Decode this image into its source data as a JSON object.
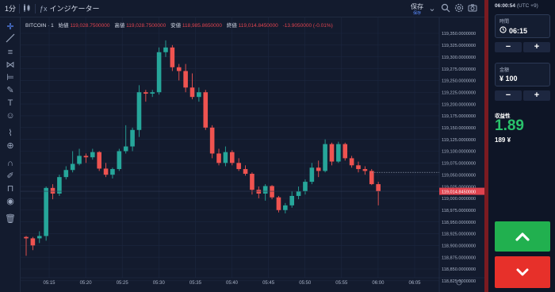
{
  "toolbar": {
    "timeframe": "1分",
    "indicators": "インジケーター",
    "save": "保存",
    "save_sub": "保存"
  },
  "legend": {
    "symbol": "BITCOIN · 1",
    "open_label": "始値",
    "open": "119,028.7500000",
    "high_label": "高値",
    "high": "119,028.7500000",
    "low_label": "安値",
    "low": "118,985.8650000",
    "close_label": "終値",
    "close": "119,014.8450000",
    "change": "-13.9050000 (-0.01%)"
  },
  "panel": {
    "clock": "06:00:54",
    "timezone": "(UTC +9)",
    "time_label": "時間",
    "time_value": "06:15",
    "amount_label": "金額",
    "amount_value": "¥ 100",
    "minus": "−",
    "plus": "+",
    "profit_label": "収益性",
    "profit_pct": "1.89",
    "profit_amt": "189 ¥"
  },
  "colors": {
    "up": "#26a69a",
    "down": "#ef5350",
    "call": "#21b04f",
    "put": "#e7302a"
  },
  "chart_data": {
    "type": "candlestick",
    "price_axis": [
      "119,350.0000000",
      "119,325.0000000",
      "119,300.0000000",
      "119,275.0000000",
      "119,250.0000000",
      "119,225.0000000",
      "119,200.0000000",
      "119,175.0000000",
      "119,150.0000000",
      "119,125.0000000",
      "119,100.0000000",
      "119,075.0000000",
      "119,050.0000000",
      "119,025.0000000",
      "119,000.0000000",
      "118,975.0000000",
      "118,950.0000000",
      "118,925.0000000",
      "118,900.0000000",
      "118,875.0000000",
      "118,850.0000000",
      "118,825.0000000"
    ],
    "ylim": [
      118825,
      119350
    ],
    "time_axis": [
      "05:15",
      "05:20",
      "05:25",
      "05:30",
      "05:35",
      "05:40",
      "05:45",
      "05:50",
      "05:55",
      "06:00",
      "06:05"
    ],
    "current_price": "119,014.8450000",
    "reference_price": 119055,
    "candles": [
      {
        "o": 118918,
        "h": 118920,
        "l": 118878,
        "c": 118915
      },
      {
        "o": 118915,
        "h": 118918,
        "l": 118890,
        "c": 118900
      },
      {
        "o": 118915,
        "h": 118930,
        "l": 118905,
        "c": 118920
      },
      {
        "o": 118920,
        "h": 119025,
        "l": 118910,
        "c": 119022
      },
      {
        "o": 119022,
        "h": 119030,
        "l": 118998,
        "c": 119010
      },
      {
        "o": 119010,
        "h": 119050,
        "l": 119005,
        "c": 119045
      },
      {
        "o": 119045,
        "h": 119068,
        "l": 119040,
        "c": 119060
      },
      {
        "o": 119060,
        "h": 119100,
        "l": 119055,
        "c": 119073
      },
      {
        "o": 119073,
        "h": 119105,
        "l": 119070,
        "c": 119090
      },
      {
        "o": 119090,
        "h": 119095,
        "l": 119075,
        "c": 119087
      },
      {
        "o": 119087,
        "h": 119105,
        "l": 119082,
        "c": 119098
      },
      {
        "o": 119098,
        "h": 119100,
        "l": 119058,
        "c": 119063
      },
      {
        "o": 119063,
        "h": 119075,
        "l": 119045,
        "c": 119050
      },
      {
        "o": 119050,
        "h": 119065,
        "l": 119042,
        "c": 119062
      },
      {
        "o": 119062,
        "h": 119105,
        "l": 119058,
        "c": 119100
      },
      {
        "o": 119100,
        "h": 119155,
        "l": 119095,
        "c": 119110
      },
      {
        "o": 119110,
        "h": 119150,
        "l": 119100,
        "c": 119145
      },
      {
        "o": 119145,
        "h": 119240,
        "l": 119130,
        "c": 119225
      },
      {
        "o": 119225,
        "h": 119230,
        "l": 119205,
        "c": 119222
      },
      {
        "o": 119222,
        "h": 119230,
        "l": 119215,
        "c": 119225
      },
      {
        "o": 119225,
        "h": 119320,
        "l": 119220,
        "c": 119310
      },
      {
        "o": 119310,
        "h": 119335,
        "l": 119300,
        "c": 119320
      },
      {
        "o": 119320,
        "h": 119325,
        "l": 119270,
        "c": 119278
      },
      {
        "o": 119278,
        "h": 119285,
        "l": 119250,
        "c": 119270
      },
      {
        "o": 119270,
        "h": 119285,
        "l": 119225,
        "c": 119235
      },
      {
        "o": 119235,
        "h": 119265,
        "l": 119210,
        "c": 119215
      },
      {
        "o": 119215,
        "h": 119235,
        "l": 119205,
        "c": 119225
      },
      {
        "o": 119225,
        "h": 119230,
        "l": 119145,
        "c": 119150
      },
      {
        "o": 119150,
        "h": 119155,
        "l": 119085,
        "c": 119095
      },
      {
        "o": 119095,
        "h": 119105,
        "l": 119070,
        "c": 119075
      },
      {
        "o": 119075,
        "h": 119110,
        "l": 119068,
        "c": 119098
      },
      {
        "o": 119098,
        "h": 119102,
        "l": 119070,
        "c": 119075
      },
      {
        "o": 119075,
        "h": 119085,
        "l": 119058,
        "c": 119062
      },
      {
        "o": 119062,
        "h": 119070,
        "l": 119048,
        "c": 119052
      },
      {
        "o": 119052,
        "h": 119055,
        "l": 119008,
        "c": 119018
      },
      {
        "o": 119018,
        "h": 119025,
        "l": 119000,
        "c": 119010
      },
      {
        "o": 119010,
        "h": 119030,
        "l": 118995,
        "c": 119026
      },
      {
        "o": 119026,
        "h": 119028,
        "l": 118998,
        "c": 119002
      },
      {
        "o": 119002,
        "h": 119005,
        "l": 118970,
        "c": 118975
      },
      {
        "o": 118975,
        "h": 118990,
        "l": 118968,
        "c": 118985
      },
      {
        "o": 118985,
        "h": 119015,
        "l": 118980,
        "c": 119005
      },
      {
        "o": 119005,
        "h": 119025,
        "l": 118998,
        "c": 119015
      },
      {
        "o": 119015,
        "h": 119040,
        "l": 119008,
        "c": 119035
      },
      {
        "o": 119035,
        "h": 119075,
        "l": 119030,
        "c": 119065
      },
      {
        "o": 119065,
        "h": 119080,
        "l": 119045,
        "c": 119058
      },
      {
        "o": 119058,
        "h": 119125,
        "l": 119055,
        "c": 119115
      },
      {
        "o": 119115,
        "h": 119118,
        "l": 119070,
        "c": 119078
      },
      {
        "o": 119078,
        "h": 119120,
        "l": 119075,
        "c": 119115
      },
      {
        "o": 119115,
        "h": 119118,
        "l": 119080,
        "c": 119085
      },
      {
        "o": 119085,
        "h": 119090,
        "l": 119065,
        "c": 119070
      },
      {
        "o": 119070,
        "h": 119078,
        "l": 119055,
        "c": 119062
      },
      {
        "o": 119062,
        "h": 119068,
        "l": 119050,
        "c": 119058
      },
      {
        "o": 119058,
        "h": 119062,
        "l": 119028,
        "c": 119030
      },
      {
        "o": 119030,
        "h": 119035,
        "l": 118985,
        "c": 119015
      }
    ]
  }
}
